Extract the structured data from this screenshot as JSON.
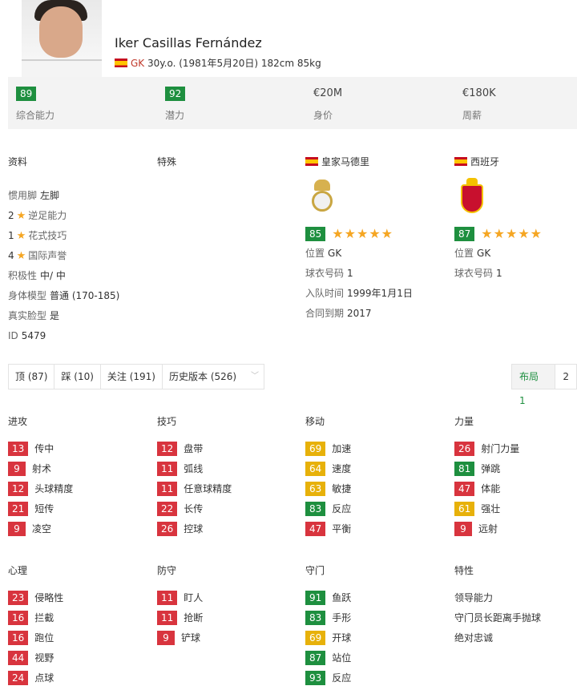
{
  "player": {
    "name": "Iker Casillas Fernández",
    "position": "GK",
    "details": "30y.o. (1981年5月20日) 182cm 85kg"
  },
  "summary": [
    {
      "value": "89",
      "label": "综合能力",
      "badge": true
    },
    {
      "value": "92",
      "label": "潜力",
      "badge": true
    },
    {
      "value": "€20M",
      "label": "身价",
      "badge": false
    },
    {
      "value": "€180K",
      "label": "周薪",
      "badge": false
    }
  ],
  "profile": {
    "title": "资料",
    "foot_label": "惯用脚",
    "foot_value": "左脚",
    "weak_foot_num": "2",
    "weak_foot_label": "逆足能力",
    "skill_num": "1",
    "skill_label": "花式技巧",
    "rep_num": "4",
    "rep_label": "国际声誉",
    "workrate_label": "积极性",
    "workrate_value": "中/ 中",
    "body_label": "身体模型",
    "body_value": "普通 (170-185)",
    "realface_label": "真实脸型",
    "realface_value": "是",
    "id_label": "ID",
    "id_value": "5479"
  },
  "specialties": {
    "title": "特殊"
  },
  "club": {
    "name": "皇家马德里",
    "rating": "85",
    "position_label": "位置",
    "position_value": "GK",
    "jersey_label": "球衣号码",
    "jersey_value": "1",
    "joined_label": "入队时间",
    "joined_value": "1999年1月1日",
    "contract_label": "合同到期",
    "contract_value": "2017"
  },
  "nation": {
    "name": "西班牙",
    "rating": "87",
    "position_label": "位置",
    "position_value": "GK",
    "jersey_label": "球衣号码",
    "jersey_value": "1"
  },
  "toolbar": {
    "up": "顶 (87)",
    "down": "踩 (10)",
    "follow": "关注 (191)",
    "history": "历史版本 (526)",
    "layout1": "布局 1",
    "layout2": "2"
  },
  "attributes": {
    "attack": {
      "title": "进攻",
      "items": [
        {
          "v": "13",
          "n": "传中",
          "c": "r"
        },
        {
          "v": "9",
          "n": "射术",
          "c": "r"
        },
        {
          "v": "12",
          "n": "头球精度",
          "c": "r"
        },
        {
          "v": "21",
          "n": "短传",
          "c": "r"
        },
        {
          "v": "9",
          "n": "凌空",
          "c": "r"
        }
      ]
    },
    "skill": {
      "title": "技巧",
      "items": [
        {
          "v": "12",
          "n": "盘带",
          "c": "r"
        },
        {
          "v": "11",
          "n": "弧线",
          "c": "r"
        },
        {
          "v": "11",
          "n": "任意球精度",
          "c": "r"
        },
        {
          "v": "22",
          "n": "长传",
          "c": "r"
        },
        {
          "v": "26",
          "n": "控球",
          "c": "r"
        }
      ]
    },
    "movement": {
      "title": "移动",
      "items": [
        {
          "v": "69",
          "n": "加速",
          "c": "y"
        },
        {
          "v": "64",
          "n": "速度",
          "c": "y"
        },
        {
          "v": "63",
          "n": "敏捷",
          "c": "y"
        },
        {
          "v": "83",
          "n": "反应",
          "c": "g"
        },
        {
          "v": "47",
          "n": "平衡",
          "c": "r"
        }
      ]
    },
    "power": {
      "title": "力量",
      "items": [
        {
          "v": "26",
          "n": "射门力量",
          "c": "r"
        },
        {
          "v": "81",
          "n": "弹跳",
          "c": "g"
        },
        {
          "v": "47",
          "n": "体能",
          "c": "r"
        },
        {
          "v": "61",
          "n": "强壮",
          "c": "y"
        },
        {
          "v": "9",
          "n": "远射",
          "c": "r"
        }
      ]
    },
    "mentality": {
      "title": "心理",
      "items": [
        {
          "v": "23",
          "n": "侵略性",
          "c": "r"
        },
        {
          "v": "16",
          "n": "拦截",
          "c": "r"
        },
        {
          "v": "16",
          "n": "跑位",
          "c": "r"
        },
        {
          "v": "44",
          "n": "视野",
          "c": "r"
        },
        {
          "v": "24",
          "n": "点球",
          "c": "r"
        }
      ]
    },
    "defending": {
      "title": "防守",
      "items": [
        {
          "v": "11",
          "n": "盯人",
          "c": "r"
        },
        {
          "v": "11",
          "n": "抢断",
          "c": "r"
        },
        {
          "v": "9",
          "n": "铲球",
          "c": "r"
        }
      ]
    },
    "goalkeeping": {
      "title": "守门",
      "items": [
        {
          "v": "91",
          "n": "鱼跃",
          "c": "g"
        },
        {
          "v": "83",
          "n": "手形",
          "c": "g"
        },
        {
          "v": "69",
          "n": "开球",
          "c": "y"
        },
        {
          "v": "87",
          "n": "站位",
          "c": "g"
        },
        {
          "v": "93",
          "n": "反应",
          "c": "g"
        }
      ]
    },
    "traits": {
      "title": "特性",
      "items": [
        "领导能力",
        "守门员长距离手抛球",
        "绝对忠诚"
      ]
    }
  },
  "colors": {
    "green": "#1e8f3f",
    "red": "#d8343e",
    "yellow": "#e7b10a"
  }
}
